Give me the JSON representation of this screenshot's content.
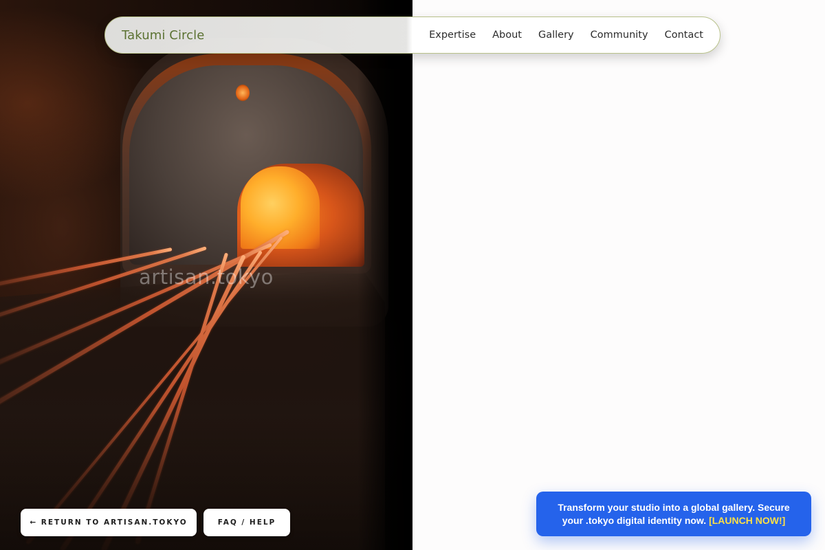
{
  "hero": {
    "image_description_icon": "glass-furnace-photo-icon",
    "domain_wordmark": "artisan.tokyo"
  },
  "nav": {
    "brand": "Takumi Circle",
    "links": [
      "Expertise",
      "About",
      "Gallery",
      "Community",
      "Contact"
    ]
  },
  "buttons": {
    "return_label": "← RETURN TO ARTISAN.TOKYO",
    "faq_label": "FAQ / HELP"
  },
  "promo": {
    "message": "Transform your studio into a global gallery. Secure your .tokyo digital identity now.",
    "cta": "[LAUNCH NOW!]"
  },
  "colors": {
    "brand_text": "#5b7232",
    "nav_border": "#b8c18a",
    "promo_bg": "#2563eb",
    "promo_cta": "#fde047",
    "page_bg": "#fdfcfc"
  }
}
